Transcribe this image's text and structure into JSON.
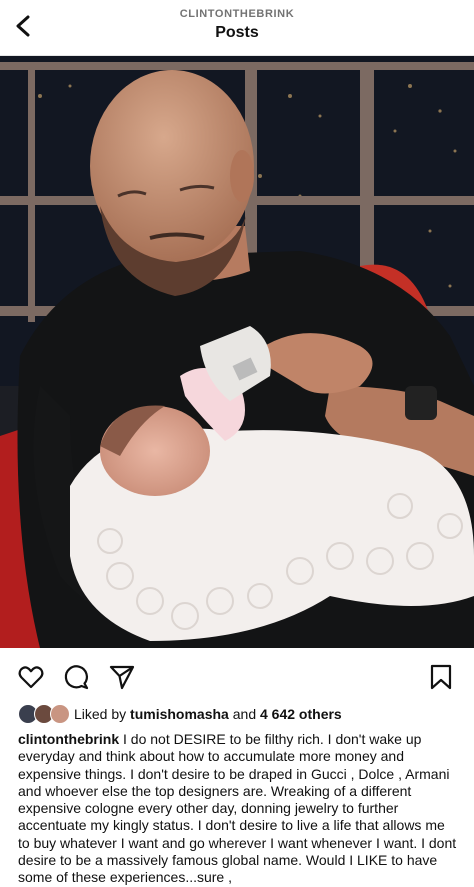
{
  "header": {
    "username": "CLINTONTHEBRINK",
    "title": "Posts"
  },
  "likes": {
    "prefix": "Liked by ",
    "user": "tumishomasha",
    "connector": " and ",
    "others": "4 642 others"
  },
  "caption": {
    "username": "clintonthebrink",
    "text": "I do not DESIRE to be filthy rich. I don't wake up everyday and think about how to accumulate more money and expensive things. I don't desire to be draped in Gucci , Dolce , Armani and whoever else the top designers are. Wreaking of a different expensive cologne every other day, donning jewelry to further accentuate my kingly status. I don't desire to live a life that allows me to buy whatever I want and go wherever I want whenever I want. I dont desire to be a massively famous global name. Would I LIKE to have some of these experiences...sure ,"
  },
  "colors": {
    "text": "#111111",
    "muted": "#737373",
    "divider": "#e6e6e6"
  }
}
